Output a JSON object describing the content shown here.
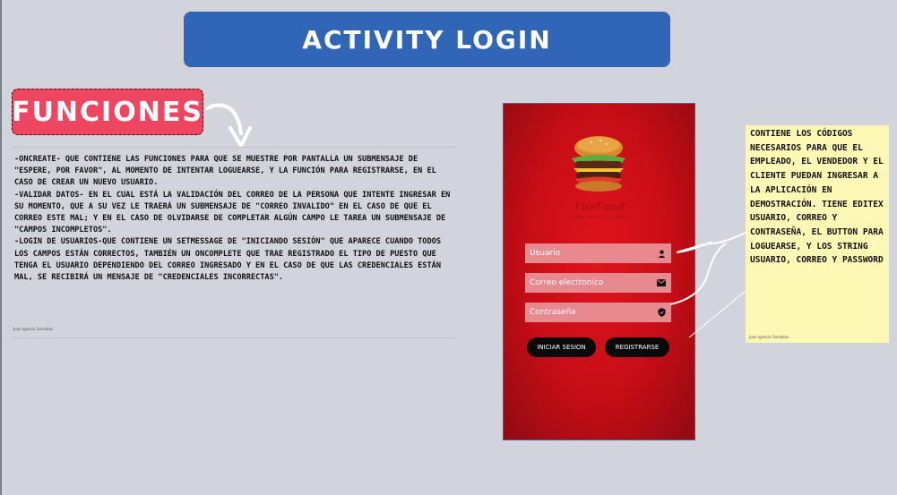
{
  "header": {
    "title": "Activity Login"
  },
  "badge": {
    "label": "Funciones"
  },
  "description": {
    "paragraphs": [
      "-onCreate- que contiene las funciones para que se muestre por pantalla un submensaje de \"espere, por favor\", al momento de intentar loguearse, y la función para registrarse, en el caso de crear un nuevo usuario.",
      "-Validar datos- en el cual está la validación del correo de la persona que intente ingresar en su momento, que a su vez le traerá un submensaje de \"correo invalido\" en el caso de que el correo este mal; y en el caso de olvidarse de completar algún campo le tarea un submensaje de \"campos incompletos\".",
      "-Login de usuarios-que contiene un setMessage de \"iniciando sesión\" que aparece cuando todos los campos están correctos, también un onComplete que trae registrado el tipo de puesto que tenga el usuario dependiendo del correo ingresado y en el caso de que las credenciales están mal, se recibirá un mensaje de \"credenciales incorrectas\"."
    ],
    "author": "Juan Ignacio González"
  },
  "phone": {
    "brand": "TheFood",
    "tagline": "comida rápida y de calidad",
    "fields": [
      {
        "label": "Usuario",
        "placeholder": "Usuario",
        "icon": "person-icon"
      },
      {
        "label": "Email",
        "placeholder": "Correo electronico",
        "icon": "mail-icon"
      },
      {
        "label": "Contraseña",
        "placeholder": "Contraseña",
        "icon": "shield-icon"
      }
    ],
    "buttons": {
      "login": "INICIAR SESION",
      "register": "REGISTRARSE"
    }
  },
  "note": {
    "text": "Contiene los códigos necesarios para que el empleado, el vendedor y el cliente puedan ingresar a la aplicación en demostración. Tiene editex usuario, correo y contraseña, el button para loguearse, y los string usuario, correo y password",
    "author": "Juan Ignacio González"
  },
  "colors": {
    "title_bg": "#3066b5",
    "badge_bg": "#ee4660",
    "phone_bg": "#d01018",
    "note_bg": "#fdf8b4"
  }
}
